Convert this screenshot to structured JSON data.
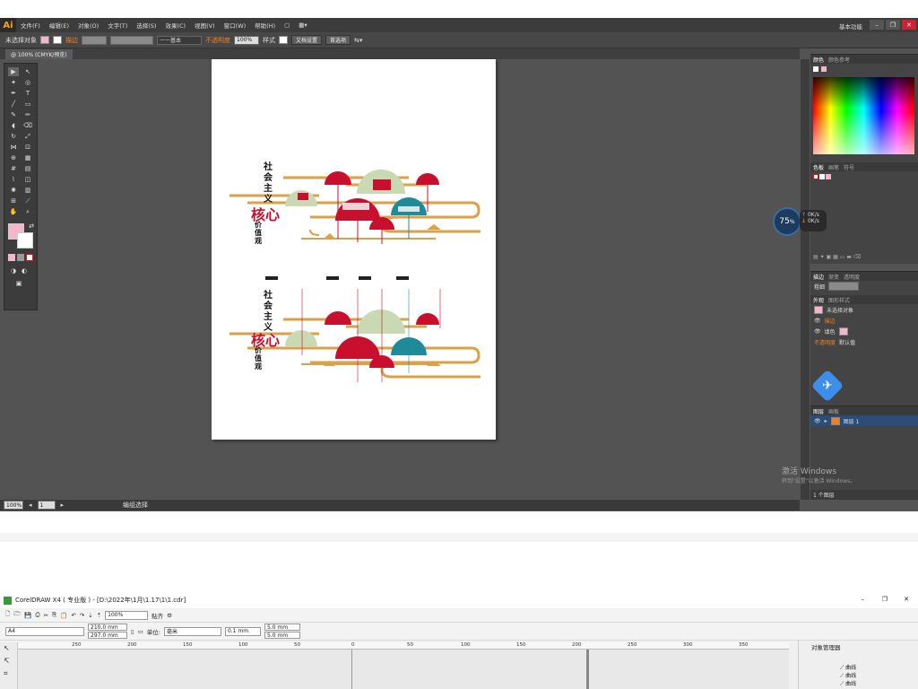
{
  "illustrator": {
    "logo": "Ai",
    "menus": [
      "文件(F)",
      "编辑(E)",
      "对象(O)",
      "文字(T)",
      "选择(S)",
      "效果(C)",
      "视图(V)",
      "窗口(W)",
      "帮助(H)"
    ],
    "workspace": "基本功能",
    "control": {
      "no_selection": "未选择对象",
      "stroke_label": "描边",
      "stroke_style": "基本",
      "opacity_label": "不透明度",
      "opacity_value": "100%",
      "style_label": "样式",
      "doc_setup": "文档设置",
      "preferences": "首选项"
    },
    "tab": "@ 100% (CMYK/预览)",
    "status": {
      "zoom": "100%",
      "page": "1",
      "mode": "编组选择"
    },
    "panels": {
      "color_tabs": [
        "颜色",
        "颜色参考"
      ],
      "swatch_tabs": [
        "色板",
        "画笔",
        "符号"
      ],
      "stroke_tabs": [
        "描边",
        "渐变",
        "透明度"
      ],
      "weight_label": "粗细",
      "appearance_tabs": [
        "外观",
        "图形样式"
      ],
      "appearance_rows": [
        "未选择对象",
        "描边",
        "填色",
        "不透明度"
      ],
      "default_value": "默认值",
      "layer_tabs": [
        "图层",
        "画板"
      ],
      "layer_name": "图层 1",
      "layer_count": "1 个图层"
    },
    "badge": {
      "percent": "75",
      "unit": "%",
      "up": "0K/s",
      "down": "0K/s"
    },
    "activation": {
      "line1": "激活 Windows",
      "line2": "转到\"设置\"以激活 Windows。"
    },
    "artwork": {
      "title_chars": [
        "社",
        "会",
        "主",
        "义"
      ],
      "core": "核心",
      "values": "价值观"
    }
  },
  "coreldraw": {
    "title": "CorelDRAW X4 ( 专业版 ) - [D:\\2022年\\1月\\1.17\\1\\1.cdr]",
    "zoom": "100%",
    "snap": "贴齐",
    "paper": "A4",
    "width": "210.0 mm",
    "height": "297.0 mm",
    "unit_label": "单位:",
    "unit": "毫米",
    "nudge": "0.1 mm",
    "dup_x": "5.0 mm",
    "dup_y": "5.0 mm",
    "ruler_ticks": [
      "250",
      "200",
      "150",
      "100",
      "50",
      "0",
      "50",
      "100",
      "150",
      "200",
      "250",
      "300",
      "350"
    ],
    "object_manager": "对象管理器",
    "curves": [
      "曲线",
      "曲线",
      "曲线"
    ]
  },
  "colors": {
    "ai_bg": "#535353",
    "accent_orange": "#f08020",
    "red": "#c8102e",
    "teal": "#1f8a9a",
    "gold": "#d9a24a"
  }
}
